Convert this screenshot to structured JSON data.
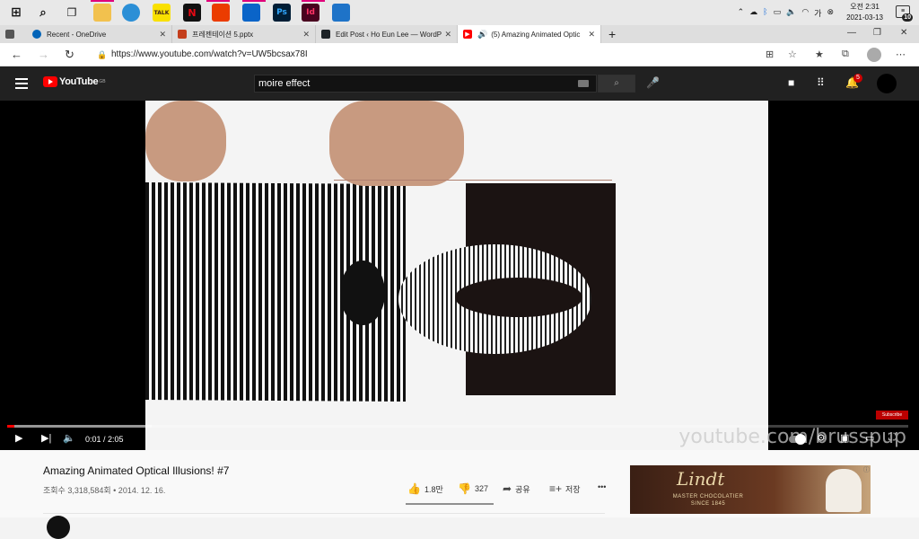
{
  "taskbar": {
    "apps": [
      {
        "icon": "windows-start-icon"
      },
      {
        "icon": "search-icon"
      },
      {
        "icon": "task-view-icon"
      },
      {
        "icon": "file-explorer-icon"
      },
      {
        "icon": "edge-icon"
      },
      {
        "icon": "kakaotalk-icon",
        "label": "TALK"
      },
      {
        "icon": "netflix-icon",
        "label": "N"
      },
      {
        "icon": "office-icon"
      },
      {
        "icon": "outlook-icon"
      },
      {
        "icon": "photoshop-icon",
        "label": "Ps"
      },
      {
        "icon": "indesign-icon",
        "label": "Id"
      },
      {
        "icon": "media-player-icon"
      }
    ],
    "clock": {
      "time": "오전 2:31",
      "date": "2021-03-13"
    },
    "notification_count": "10"
  },
  "browser": {
    "tabs": [
      {
        "title": "Recent - OneDrive",
        "icon": "onedrive-icon"
      },
      {
        "title": "프레젠테이션 5.pptx",
        "icon": "powerpoint-icon"
      },
      {
        "title": "Edit Post ‹ Ho Eun Lee — WordP",
        "icon": "wordpress-icon"
      },
      {
        "title": "(5) Amazing Animated Optic",
        "icon": "youtube-icon",
        "active": true
      }
    ],
    "url": "https://www.youtube.com/watch?v=UW5bcsax78I"
  },
  "youtube": {
    "logo_text": "YouTube",
    "region": "GB",
    "search_value": "moire effect",
    "notification_badge": "5",
    "player": {
      "watermark": "youtube.com/brusspup",
      "subscribe_badge": "Subscribe",
      "time": "0:01 / 2:05",
      "progress_fraction": 0.008,
      "buffered_fraction": 0.16
    },
    "video": {
      "title": "Amazing Animated Optical Illusions! #7",
      "meta": "조회수 3,318,584회 • 2014. 12. 16.",
      "likes": "1.8만",
      "dislikes": "327",
      "share": "공유",
      "save": "저장",
      "more": "•••"
    },
    "ad": {
      "brand": "Lindt",
      "tagline1": "MASTER CHOCOLATIER",
      "tagline2": "SINCE 1845"
    }
  }
}
